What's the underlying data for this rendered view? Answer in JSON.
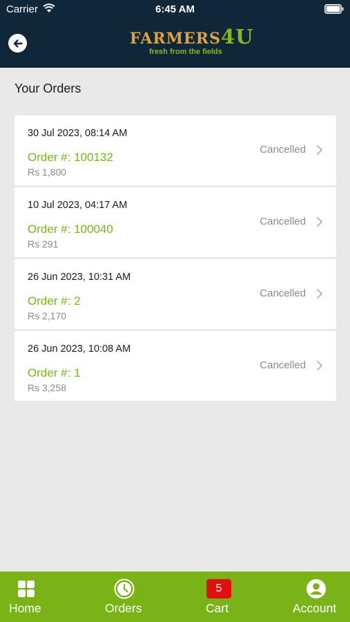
{
  "status_bar": {
    "carrier": "Carrier",
    "time": "6:45 AM"
  },
  "header": {
    "logo_word": "FARMERS",
    "logo_num": "4U",
    "logo_tagline": "fresh from the fields"
  },
  "page_title": "Your Orders",
  "orders": [
    {
      "date": "30 Jul 2023, 08:14 AM",
      "number": "Order #: 100132",
      "amount": "Rs 1,800",
      "status": "Cancelled"
    },
    {
      "date": "10 Jul 2023, 04:17 AM",
      "number": "Order #: 100040",
      "amount": "Rs 291",
      "status": "Cancelled"
    },
    {
      "date": "26 Jun 2023, 10:31 AM",
      "number": "Order #: 2",
      "amount": "Rs 2,170",
      "status": "Cancelled"
    },
    {
      "date": "26 Jun 2023, 10:08 AM",
      "number": "Order #: 1",
      "amount": "Rs 3,258",
      "status": "Cancelled"
    }
  ],
  "tab_bar": {
    "home_label": "Home",
    "orders_label": "Orders",
    "cart_label": "Cart",
    "cart_count": "5",
    "account_label": "Account"
  },
  "colors": {
    "header_bg": "#0f2738",
    "accent_green": "#7ab317",
    "logo_gold": "#e0a23a",
    "badge_red": "#e01010"
  }
}
